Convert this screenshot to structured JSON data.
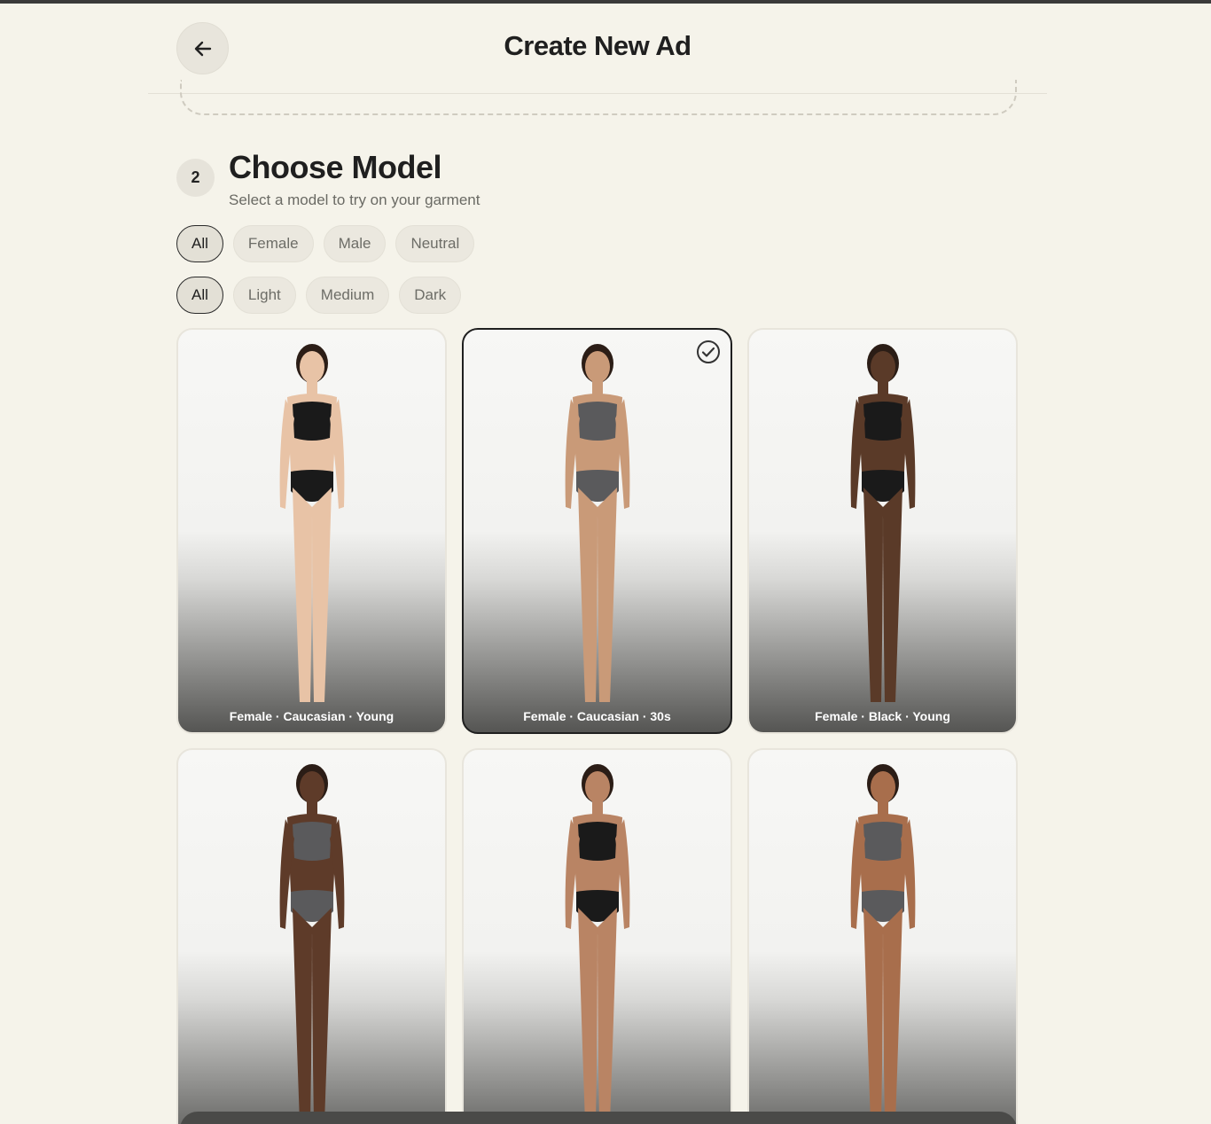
{
  "header": {
    "title": "Create New Ad",
    "back_icon": "arrow-left-icon"
  },
  "step": {
    "number": "2",
    "title": "Choose Model",
    "subtitle": "Select a model to try on your garment"
  },
  "gender_filters": {
    "selected": "All",
    "options": [
      "All",
      "Female",
      "Male",
      "Neutral"
    ]
  },
  "skin_filters": {
    "selected": "All",
    "options": [
      "All",
      "Light",
      "Medium",
      "Dark"
    ]
  },
  "models": [
    {
      "label": "Female · Caucasian · Young",
      "selected": false,
      "skin": "#e8c3a6",
      "outfit": "#1a1a1a"
    },
    {
      "label": "Female · Caucasian · 30s",
      "selected": true,
      "skin": "#c99a78",
      "outfit": "#5a5a5c"
    },
    {
      "label": "Female · Black · Young",
      "selected": false,
      "skin": "#5a3a28",
      "outfit": "#1a1a1a"
    },
    {
      "label": "",
      "selected": false,
      "skin": "#5e3b29",
      "outfit": "#5a5a5c"
    },
    {
      "label": "",
      "selected": false,
      "skin": "#b98464",
      "outfit": "#1a1a1a"
    },
    {
      "label": "",
      "selected": false,
      "skin": "#a86e4c",
      "outfit": "#5a5a5c"
    }
  ],
  "colors": {
    "background": "#f5f3ea",
    "selected_border": "#1f1f1f"
  }
}
